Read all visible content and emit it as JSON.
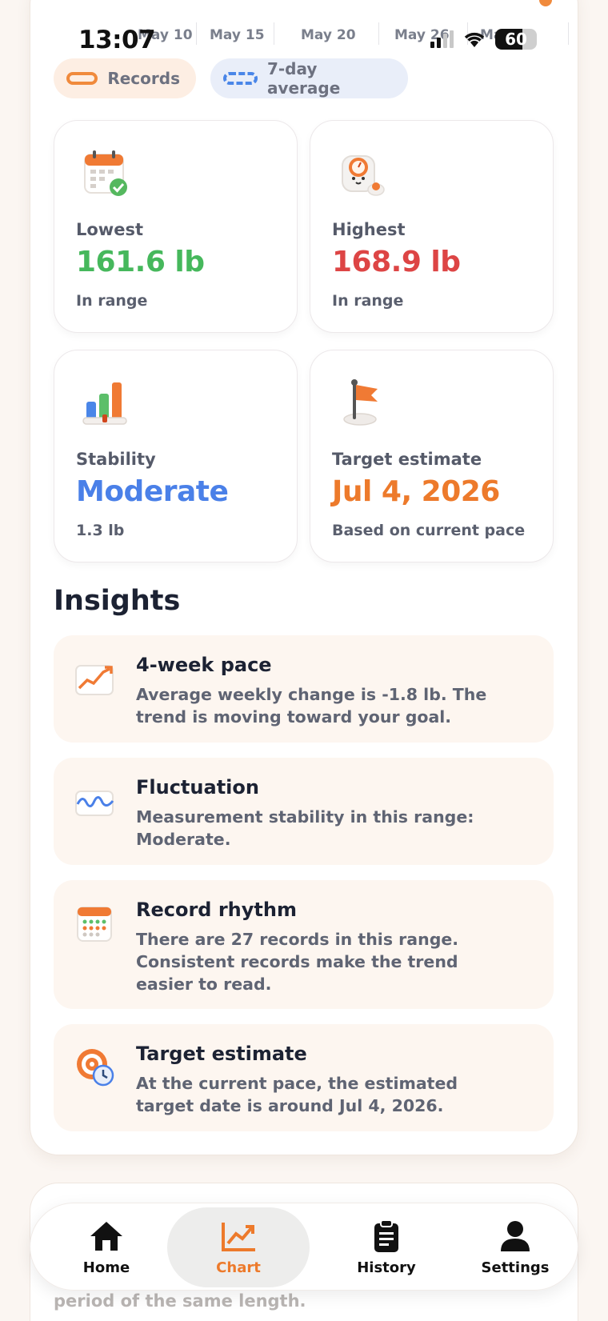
{
  "status_bar": {
    "time": "13:07",
    "battery": "60"
  },
  "chart_axis": {
    "ticks": [
      "May 10",
      "May 15",
      "May 20",
      "May 26",
      "May"
    ]
  },
  "legend": {
    "records": "Records",
    "avg": "7-day average"
  },
  "stats": {
    "lowest": {
      "label": "Lowest",
      "value": "161.6 lb",
      "sub": "In range"
    },
    "highest": {
      "label": "Highest",
      "value": "168.9 lb",
      "sub": "In range"
    },
    "stability": {
      "label": "Stability",
      "value": "Moderate",
      "sub": "1.3 lb"
    },
    "target": {
      "label": "Target estimate",
      "value": "Jul 4, 2026",
      "sub": "Based on current pace"
    }
  },
  "insights": {
    "title": "Insights",
    "items": [
      {
        "icon": "trend-chart-icon",
        "title": "4-week pace",
        "desc": "Average weekly change is -1.8 lb. The trend is moving toward your goal."
      },
      {
        "icon": "wave-icon",
        "title": "Fluctuation",
        "desc": "Measurement stability in this range: Moderate."
      },
      {
        "icon": "calendar-icon",
        "title": "Record rhythm",
        "desc": "There are 27 records in this range. Consistent records make the trend easier to read."
      },
      {
        "icon": "target-clock-icon",
        "title": "Target estimate",
        "desc": "At the current pace, the estimated target date is around Jul 4, 2026."
      }
    ]
  },
  "bottom_card": {
    "ghost_text": "period of the same length."
  },
  "nav": {
    "items": [
      {
        "label": "Home",
        "icon": "home-icon"
      },
      {
        "label": "Chart",
        "icon": "chart-icon",
        "active": true
      },
      {
        "label": "History",
        "icon": "clipboard-icon"
      },
      {
        "label": "Settings",
        "icon": "person-icon"
      }
    ]
  },
  "colors": {
    "accent_orange": "#ed7a2b",
    "green": "#46b85c",
    "red": "#dd4545",
    "blue": "#4a80e8",
    "background": "#fbf6f2"
  }
}
